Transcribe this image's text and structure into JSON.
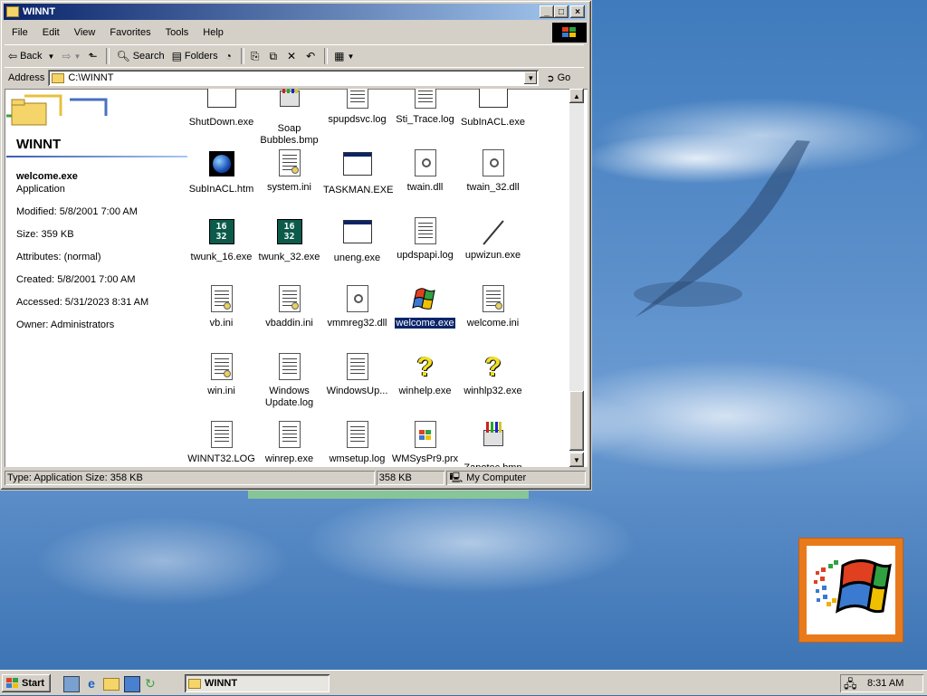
{
  "window": {
    "title": "WINNT",
    "menu": [
      "File",
      "Edit",
      "View",
      "Favorites",
      "Tools",
      "Help"
    ],
    "toolbar": {
      "back": "Back",
      "search": "Search",
      "folders": "Folders"
    },
    "address": {
      "label": "Address",
      "value": "C:\\WINNT",
      "go": "Go"
    },
    "left_pane": {
      "folder_title": "WINNT",
      "file_name": "welcome.exe",
      "file_type": "Application",
      "modified": "Modified: 5/8/2001 7:00 AM",
      "size": "Size: 359 KB",
      "attributes": "Attributes: (normal)",
      "created": "Created: 5/8/2001 7:00 AM",
      "accessed": "Accessed: 5/31/2023 8:31 AM",
      "owner": "Owner: Administrators"
    },
    "files": [
      {
        "name": "ShutDown.exe",
        "icon": "blank-app-icon"
      },
      {
        "name": "Soap Bubbles.bmp",
        "icon": "paint-bucket-icon"
      },
      {
        "name": "spupdsvc.log",
        "icon": "text-doc-icon"
      },
      {
        "name": "Sti_Trace.log",
        "icon": "text-doc-icon"
      },
      {
        "name": "SubInACL.exe",
        "icon": "blank-app-icon"
      },
      {
        "name": "SubInACL.htm",
        "icon": "blue-orb-icon"
      },
      {
        "name": "system.ini",
        "icon": "config-doc-icon"
      },
      {
        "name": "TASKMAN.EXE",
        "icon": "app-window-icon"
      },
      {
        "name": "twain.dll",
        "icon": "gear-doc-icon"
      },
      {
        "name": "twain_32.dll",
        "icon": "gear-doc-icon"
      },
      {
        "name": "twunk_16.exe",
        "icon": "twunk-icon"
      },
      {
        "name": "twunk_32.exe",
        "icon": "twunk-icon"
      },
      {
        "name": "uneng.exe",
        "icon": "app-window-icon"
      },
      {
        "name": "updspapi.log",
        "icon": "text-doc-icon"
      },
      {
        "name": "upwizun.exe",
        "icon": "pen-icon"
      },
      {
        "name": "vb.ini",
        "icon": "config-doc-icon"
      },
      {
        "name": "vbaddin.ini",
        "icon": "config-doc-icon"
      },
      {
        "name": "vmmreg32.dll",
        "icon": "gear-doc-icon"
      },
      {
        "name": "welcome.exe",
        "icon": "windows-flag-icon",
        "selected": true
      },
      {
        "name": "welcome.ini",
        "icon": "config-doc-icon"
      },
      {
        "name": "win.ini",
        "icon": "config-doc-icon"
      },
      {
        "name": "Windows Update.log",
        "icon": "text-doc-icon"
      },
      {
        "name": "WindowsUp...",
        "icon": "text-doc-icon"
      },
      {
        "name": "winhelp.exe",
        "icon": "help-question-icon"
      },
      {
        "name": "winhlp32.exe",
        "icon": "help-question-icon"
      },
      {
        "name": "WINNT32.LOG",
        "icon": "text-doc-icon"
      },
      {
        "name": "winrep.exe",
        "icon": "report-doc-icon"
      },
      {
        "name": "wmsetup.log",
        "icon": "text-doc-icon"
      },
      {
        "name": "WMSysPr9.prx",
        "icon": "windows-doc-icon"
      },
      {
        "name": "Zapotec.bmp",
        "icon": "paint-bucket-icon"
      }
    ],
    "status": {
      "type_size": "Type: Application Size: 358 KB",
      "size": "358 KB",
      "zone": "My Computer"
    }
  },
  "taskbar": {
    "start": "Start",
    "task": "WINNT",
    "clock": "8:31 AM"
  },
  "colors": {
    "title_start": "#0a246a",
    "title_end": "#a6caf0",
    "selection": "#0a246a",
    "logo_orange": "#e87a1c"
  }
}
